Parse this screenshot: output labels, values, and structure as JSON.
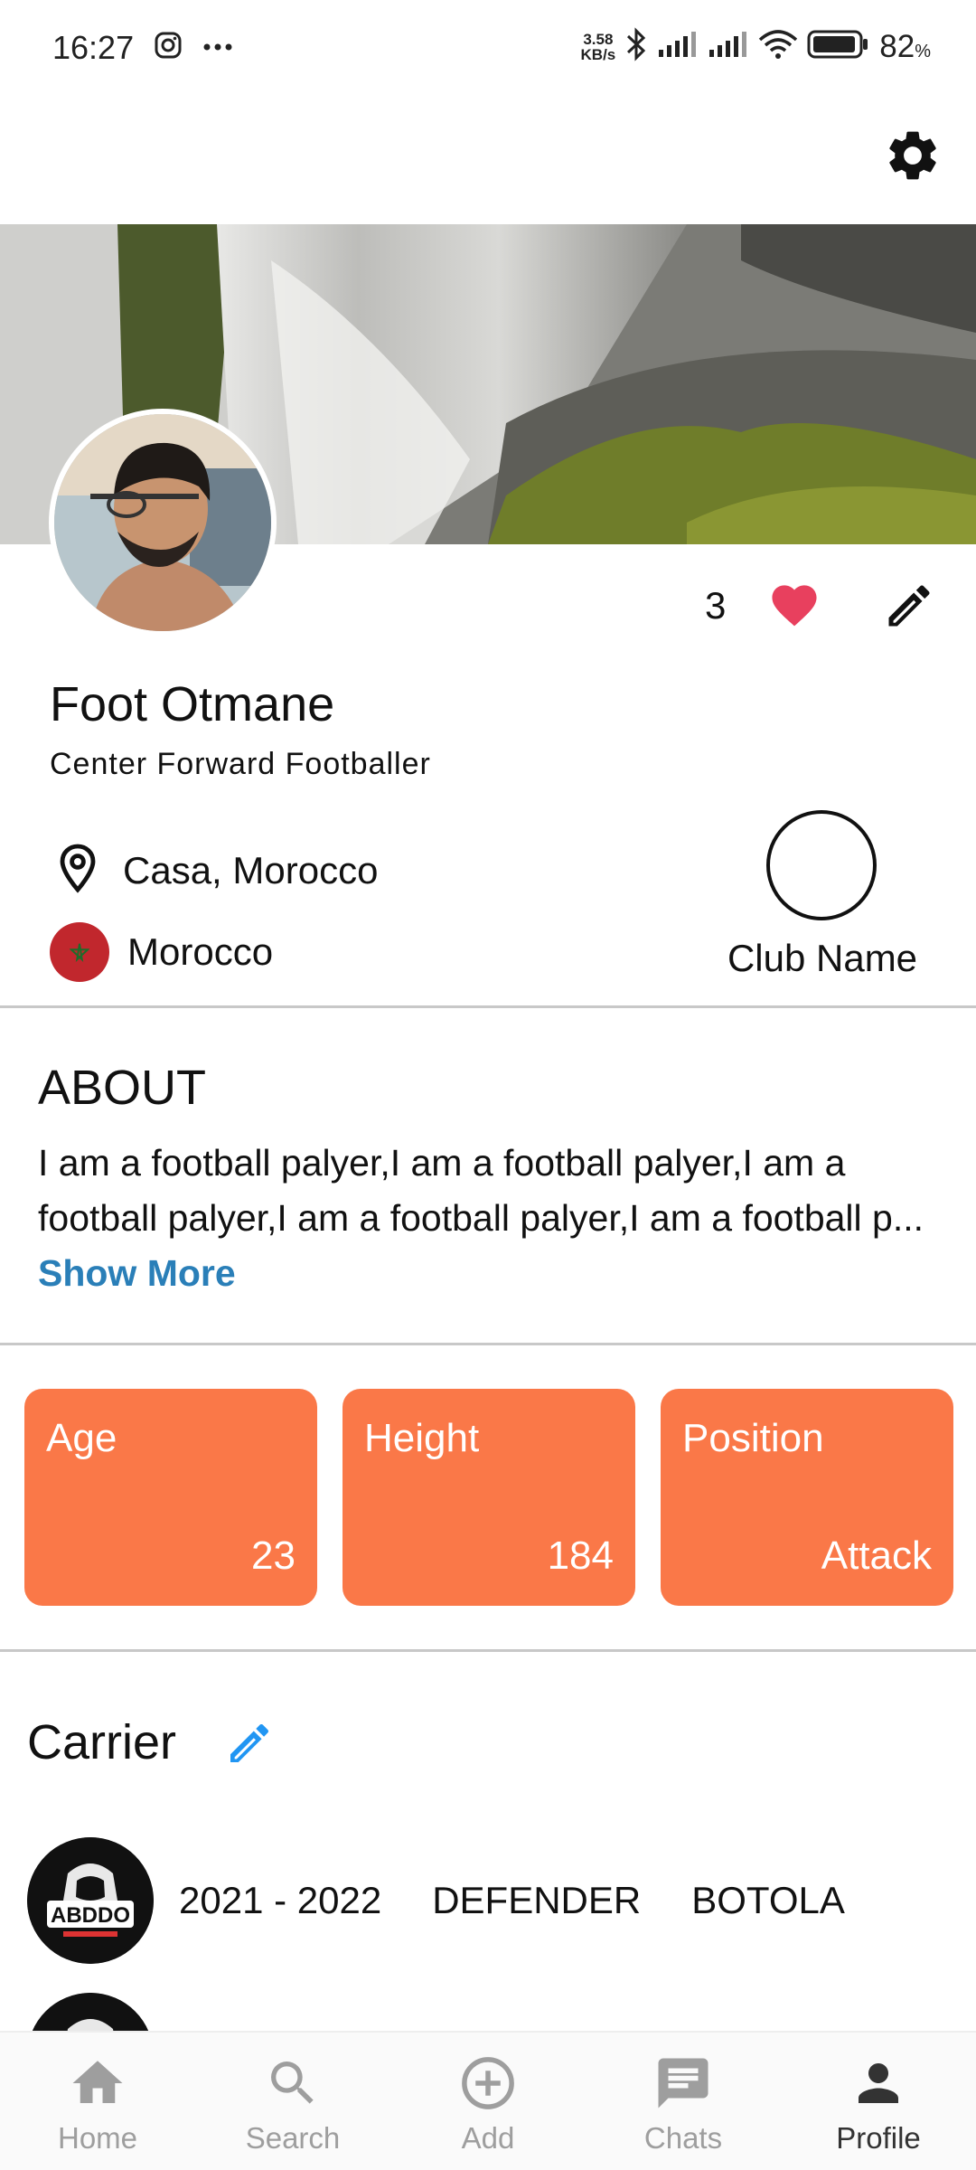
{
  "status_bar": {
    "time": "16:27",
    "net_speed_value": "3.58",
    "net_speed_unit": "KB/s",
    "battery_percent": "82",
    "battery_symbol": "%",
    "icons": [
      "instagram-icon",
      "more-dots-icon",
      "bluetooth-icon",
      "signal-icon",
      "signal-icon",
      "wifi-icon",
      "battery-icon"
    ]
  },
  "header": {
    "settings_icon": "gear-icon"
  },
  "profile": {
    "likes_count": "3",
    "name": "Foot Otmane",
    "subtitle": "Center Forward Footballer",
    "location": "Casa, Morocco",
    "country": "Morocco",
    "club_name": "Club Name"
  },
  "about": {
    "title": "ABOUT",
    "text": "I am a football palyer,I am a football palyer,I am a football palyer,I am a football palyer,I am a football p...",
    "show_more": "Show More"
  },
  "stats": [
    {
      "label": "Age",
      "value": "23"
    },
    {
      "label": "Height",
      "value": "184"
    },
    {
      "label": "Position",
      "value": "Attack"
    }
  ],
  "carrier": {
    "title": "Carrier",
    "entries": [
      {
        "badge_text": "ABDDO",
        "season": "2021 - 2022",
        "role": "DEFENDER",
        "league": "BOTOLA"
      }
    ]
  },
  "bottom_nav": [
    {
      "label": "Home",
      "icon": "home-icon"
    },
    {
      "label": "Search",
      "icon": "search-icon"
    },
    {
      "label": "Add",
      "icon": "add-circle-icon"
    },
    {
      "label": "Chats",
      "icon": "chat-icon"
    },
    {
      "label": "Profile",
      "icon": "person-icon",
      "active": true
    }
  ],
  "colors": {
    "accent": "#fa7848",
    "link": "#2a7fb8",
    "heart": "#e8405e",
    "edit_blue": "#2196f3",
    "flag_red": "#c1272d"
  }
}
